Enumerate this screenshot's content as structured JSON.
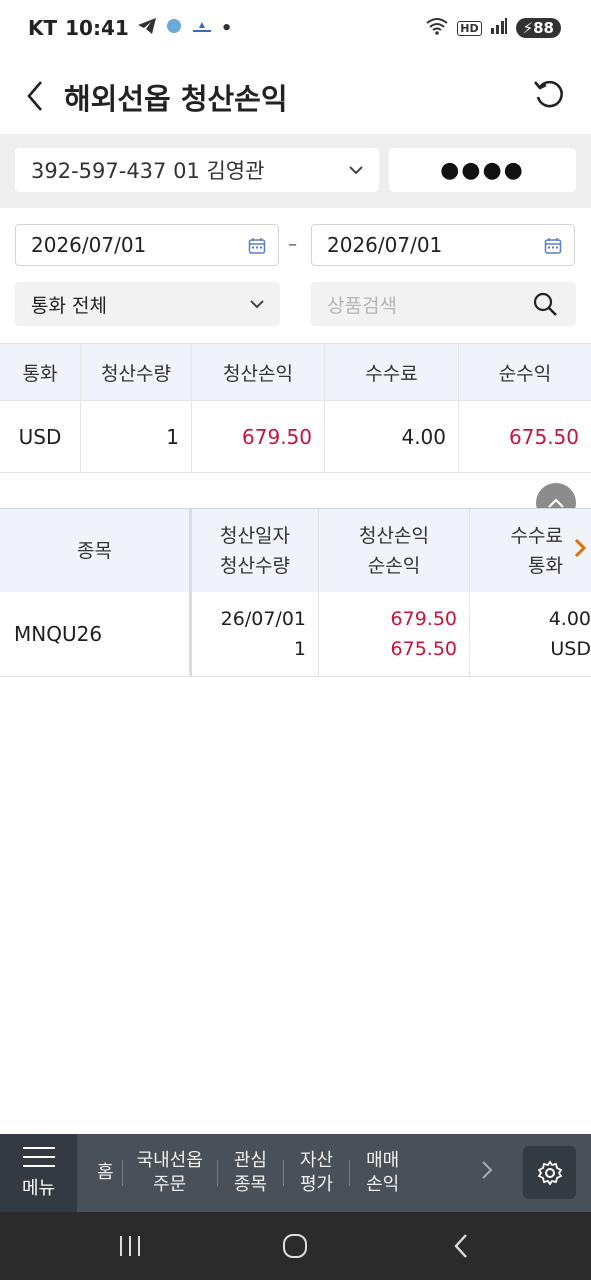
{
  "status_bar": {
    "carrier": "KT",
    "time": "10:41",
    "battery": "88",
    "hd_label": "HD"
  },
  "header": {
    "title": "해외선옵 청산손익"
  },
  "account": {
    "number": "392-597-437 01 김영관",
    "password_mask": "●●●●"
  },
  "filters": {
    "start_date": "2026/07/01",
    "separator": "–",
    "end_date": "2026/07/01",
    "currency": "통화 전체",
    "search_placeholder": "상품검색"
  },
  "summary": {
    "headers": [
      "통화",
      "청산수량",
      "청산손익",
      "수수료",
      "순수익"
    ],
    "row": {
      "currency": "USD",
      "qty": "1",
      "pnl": "679.50",
      "fee": "4.00",
      "net": "675.50"
    }
  },
  "detail": {
    "headers": {
      "item": "종목",
      "date": "청산일자",
      "qty": "청산수량",
      "pnl": "청산손익",
      "net": "순손익",
      "fee": "수수료",
      "currency": "통화"
    },
    "row": {
      "item": "MNQU26",
      "date": "26/07/01",
      "qty": "1",
      "pnl": "679.50",
      "net": "675.50",
      "fee": "4.00",
      "currency": "USD"
    }
  },
  "bottom_nav": {
    "menu": "메뉴",
    "items": [
      {
        "line1": "홈",
        "line2": ""
      },
      {
        "line1": "국내선옵",
        "line2": "주문"
      },
      {
        "line1": "관심",
        "line2": "종목"
      },
      {
        "line1": "자산",
        "line2": "평가"
      },
      {
        "line1": "매매",
        "line2": "손익"
      }
    ]
  },
  "colors": {
    "loss_profit_red": "#c8143c",
    "nav_bg": "#4a5058",
    "header_row_bg": "#f0f3f9"
  }
}
